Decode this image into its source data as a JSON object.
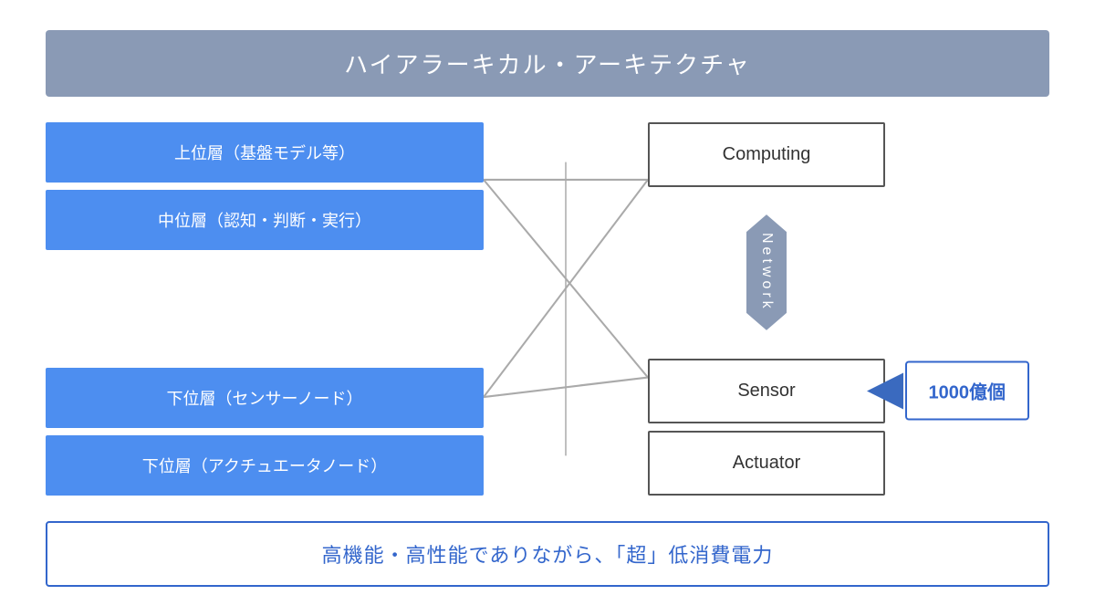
{
  "title": "ハイアラーキカル・アーキテクチャ",
  "layers": {
    "upper": "上位層（基盤モデル等）",
    "middle": "中位層（認知・判断・実行）",
    "lower_sensor": "下位層（センサーノード）",
    "lower_actuator": "下位層（アクチュエータノード）"
  },
  "right_boxes": {
    "computing": "Computing",
    "network": "Network",
    "sensor": "Sensor",
    "actuator": "Actuator"
  },
  "badge": "1000億個",
  "bottom_message": "高機能・高性能でありながら、「超」低消費電力"
}
